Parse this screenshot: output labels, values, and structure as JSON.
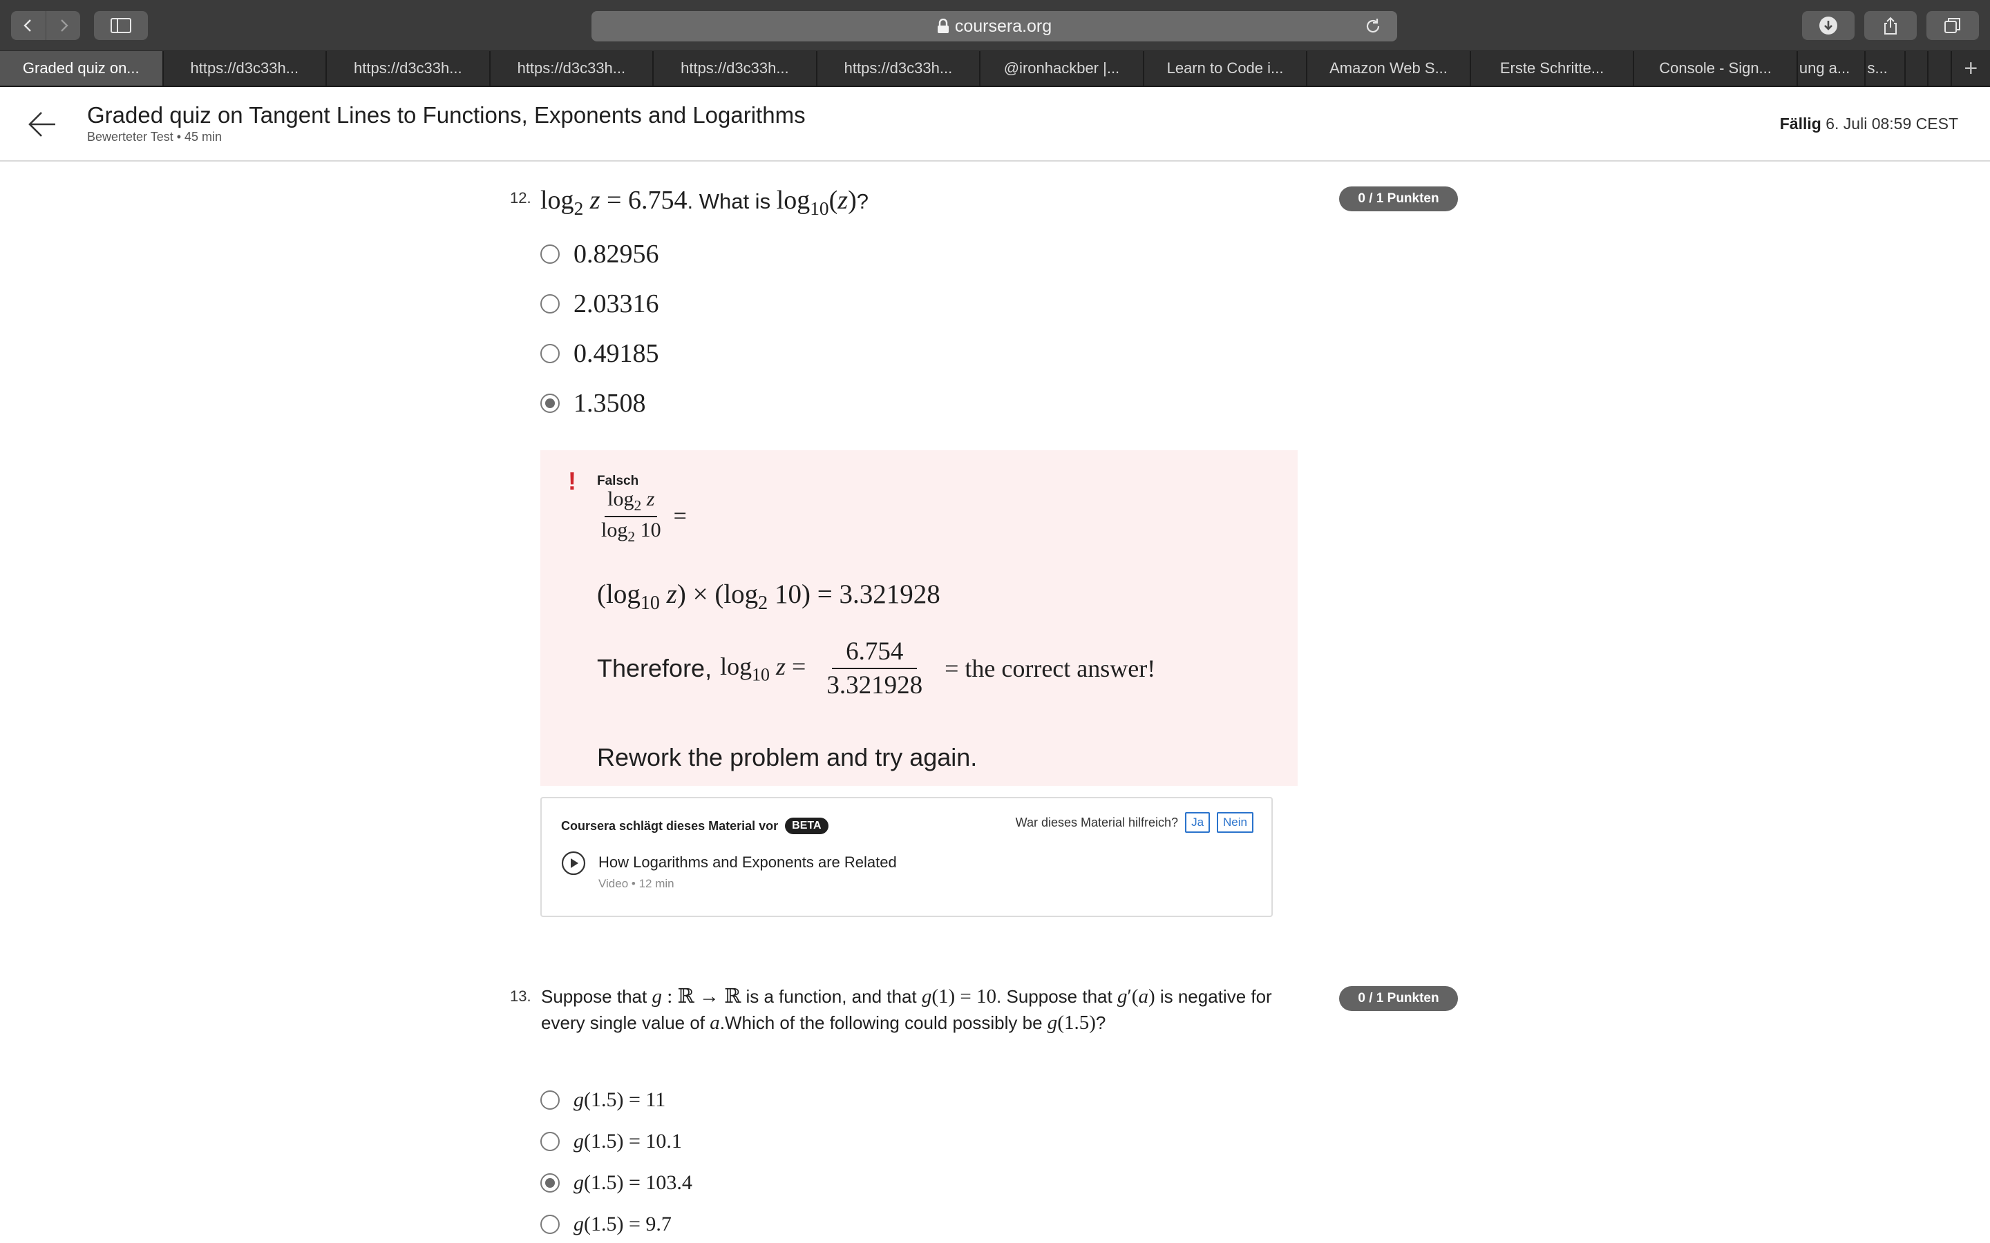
{
  "browser": {
    "url": "coursera.org",
    "tabs": [
      "Graded quiz on...",
      "https://d3c33h...",
      "https://d3c33h...",
      "https://d3c33h...",
      "https://d3c33h...",
      "https://d3c33h...",
      "@ironhackber |...",
      "Learn to Code i...",
      "Amazon Web S...",
      "Erste Schritte...",
      "Console - Sign...",
      "ung a...",
      "s..."
    ]
  },
  "header": {
    "title": "Graded quiz on Tangent Lines to Functions, Exponents and Logarithms",
    "subtitle": "Bewerteter Test • 45 min",
    "due_label": "Fällig",
    "due_value": "6. Juli 08:59 CEST"
  },
  "q12": {
    "number": "12.",
    "points": "0 / 1 Punkten",
    "question_mid": ". What is ",
    "question_end": "?",
    "options": [
      "0.82956",
      "2.03316",
      "0.49185",
      "1.3508"
    ],
    "selected_index": 3,
    "feedback": {
      "status": "Falsch",
      "line2_value": "3.321928",
      "therefore": "Therefore,",
      "numerator": "6.754",
      "denominator": "3.321928",
      "result_text": "the correct answer!",
      "closing": "Rework the problem and try again."
    },
    "recommendation": {
      "header": "Coursera schlägt dieses Material vor",
      "beta": "BETA",
      "helpful_question": "War dieses Material hilfreich?",
      "yes": "Ja",
      "no": "Nein",
      "item_title": "How Logarithms and Exponents are Related",
      "item_meta": "Video • 12 min"
    }
  },
  "q13": {
    "number": "13.",
    "points": "0 / 1 Punkten",
    "text_1": "Suppose that ",
    "text_2": " is a function, and that ",
    "text_3": ". Suppose that ",
    "text_4": " is negative for every single value of ",
    "text_5": ".Which of the following could possibly be ",
    "text_6": "?",
    "options": [
      "11",
      "10.1",
      "103.4",
      "9.7"
    ],
    "selected_index": 2
  }
}
